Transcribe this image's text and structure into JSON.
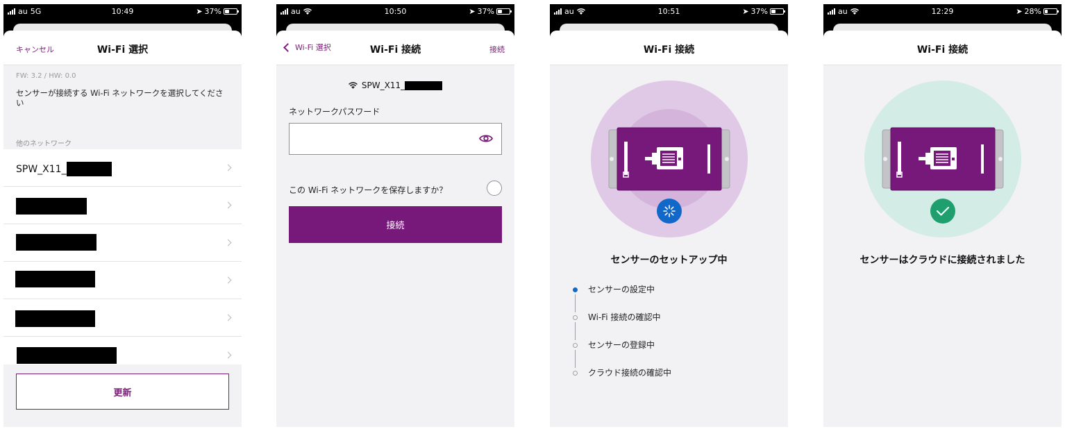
{
  "colors": {
    "brand": "#77187b",
    "progress_blue": "#1168c8",
    "success_green": "#1f9f6e"
  },
  "screen1": {
    "status": {
      "carrier": "au",
      "network": "5G",
      "time": "10:49",
      "battery": "37%"
    },
    "nav": {
      "cancel_label": "キャンセル",
      "title": "Wi-Fi 選択"
    },
    "fw_info": "FW: 3.2 / HW: 0.0",
    "instruction": "センサーが接続する Wi-Fi ネットワークを選択してください",
    "section_label": "他のネットワーク",
    "networks": [
      {
        "name": "SPW_X11_",
        "redacted": true
      },
      {
        "name": "",
        "redacted": true
      },
      {
        "name": "",
        "redacted": true
      },
      {
        "name": "",
        "redacted": true
      },
      {
        "name": "",
        "redacted": true
      },
      {
        "name": "",
        "redacted": true
      }
    ],
    "refresh_label": "更新"
  },
  "screen2": {
    "status": {
      "carrier": "au",
      "time": "10:50",
      "battery": "37%"
    },
    "nav": {
      "back_label": "Wi-Fi 選択",
      "title": "Wi-Fi 接続",
      "connect_label": "接続"
    },
    "ssid": "SPW_X11_",
    "password_label": "ネットワークパスワード",
    "password_value": "",
    "save_question": "この Wi-Fi ネットワークを保存しますか？",
    "connect_button": "接続",
    "icons": {
      "wifi": "wifi-icon",
      "eye": "eye-icon"
    }
  },
  "screen3": {
    "status": {
      "carrier": "au",
      "time": "10:51",
      "battery": "37%"
    },
    "nav": {
      "title": "Wi-Fi 接続"
    },
    "heading": "センサーのセットアップ中",
    "steps": [
      {
        "label": "センサーの設定中",
        "active": true
      },
      {
        "label": "Wi-Fi 接続の確認中",
        "active": false
      },
      {
        "label": "センサーの登録中",
        "active": false
      },
      {
        "label": "クラウド接続の確認中",
        "active": false
      }
    ]
  },
  "screen4": {
    "status": {
      "carrier": "au",
      "time": "12:29",
      "battery": "28%"
    },
    "nav": {
      "title": "Wi-Fi 接続"
    },
    "heading": "センサーはクラウドに接続されました"
  }
}
